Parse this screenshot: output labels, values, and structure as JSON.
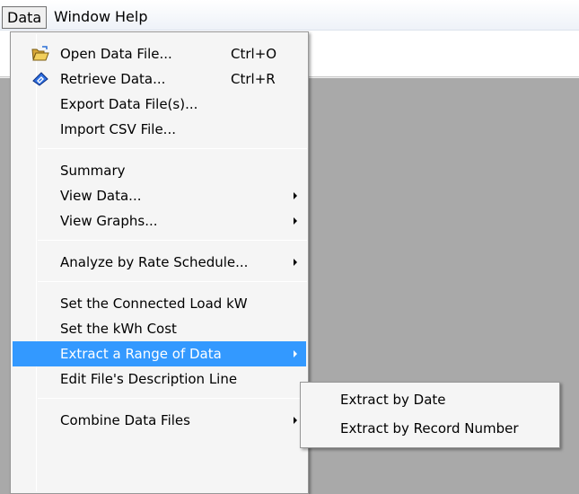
{
  "menubar": {
    "data": "Data",
    "window": "Window",
    "help": "Help"
  },
  "menu": {
    "items": [
      {
        "label": "Open Data File...",
        "shortcut": "Ctrl+O",
        "icon": "open-folder-icon"
      },
      {
        "label": "Retrieve Data...",
        "shortcut": "Ctrl+R",
        "icon": "retrieve-data-icon"
      },
      {
        "label": "Export Data File(s)..."
      },
      {
        "label": "Import CSV File..."
      },
      {
        "label": "Summary"
      },
      {
        "label": "View Data...",
        "submenu": true
      },
      {
        "label": "View Graphs...",
        "submenu": true
      },
      {
        "label": "Analyze by Rate Schedule...",
        "submenu": true
      },
      {
        "label": "Set the Connected Load kW"
      },
      {
        "label": "Set the kWh Cost"
      },
      {
        "label": "Extract a Range of Data",
        "submenu": true,
        "highlighted": true
      },
      {
        "label": "Edit File's Description Line"
      },
      {
        "label": "Combine Data Files",
        "submenu": true
      }
    ]
  },
  "submenu": {
    "items": [
      {
        "label": "Extract by Date"
      },
      {
        "label": "Extract by Record Number"
      }
    ]
  },
  "colors": {
    "highlight": "#3399ff",
    "workspace": "#a9a9a9",
    "menu_bg": "#f5f5f5"
  }
}
